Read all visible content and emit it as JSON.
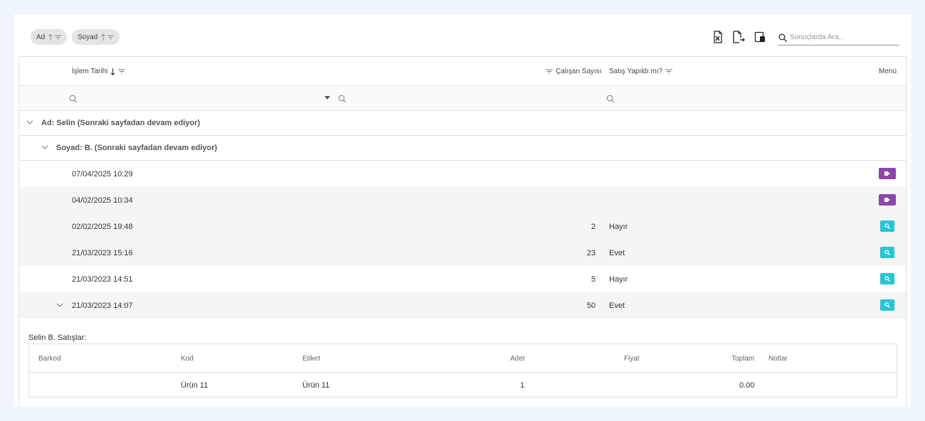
{
  "toolbar": {
    "chips": [
      {
        "label": "Ad"
      },
      {
        "label": "Soyad"
      }
    ],
    "search_placeholder": "Sonuçlarda Ara..."
  },
  "grid": {
    "columns": {
      "date": "İşlem Tarihi",
      "employees": "Çalışan Sayısı",
      "sale": "Satış Yapıldı mı?",
      "menu": "Menü"
    },
    "group1": "Ad: Selin (Sonraki sayfadan devam ediyor)",
    "group2": "Soyad: B. (Sonraki sayfadan devam ediyor)",
    "rows": [
      {
        "date": "07/04/2025 10:29",
        "count": "",
        "sale": "",
        "action": "edit"
      },
      {
        "date": "04/02/2025 10:34",
        "count": "",
        "sale": "",
        "action": "edit"
      },
      {
        "date": "02/02/2025 19:48",
        "count": "2",
        "sale": "Hayır",
        "action": "view"
      },
      {
        "date": "21/03/2023 15:16",
        "count": "23",
        "sale": "Evet",
        "action": "view"
      },
      {
        "date": "21/03/2023 14:51",
        "count": "5",
        "sale": "Hayır",
        "action": "view"
      },
      {
        "date": "21/03/2023 14:07",
        "count": "50",
        "sale": "Evet",
        "action": "view"
      }
    ]
  },
  "detail": {
    "title": "Selin B. Satışlar:",
    "columns": {
      "barcode": "Barkod",
      "code": "Kod",
      "label": "Etiket",
      "qty": "Adet",
      "price": "Fiyat",
      "total": "Toplam",
      "notes": "Notlar"
    },
    "row": {
      "barcode": "",
      "code": "Ürün 11",
      "label": "Ürün 11",
      "qty": "1",
      "price": "",
      "total": "0.00",
      "notes": ""
    }
  },
  "colors": {
    "edit_button": "#8e44ad",
    "view_button": "#26c6da"
  }
}
